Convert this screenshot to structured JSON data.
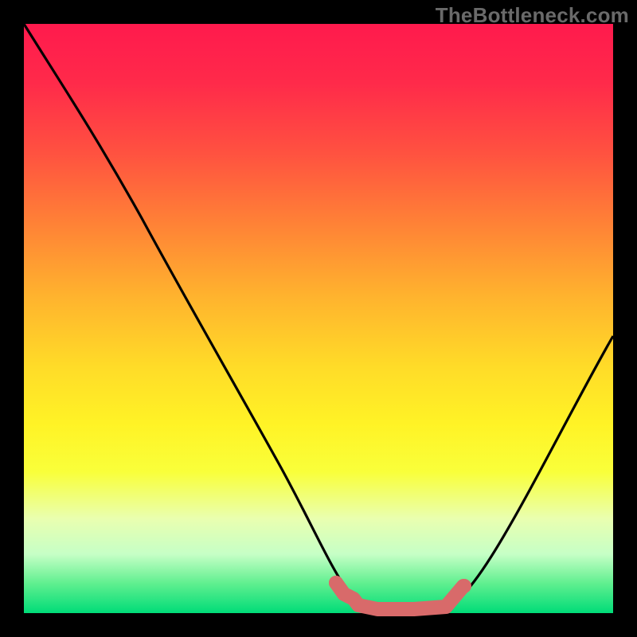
{
  "watermark": "TheBottleneck.com",
  "chart_data": {
    "type": "line",
    "title": "",
    "xlabel": "",
    "ylabel": "",
    "xlim": [
      0,
      1
    ],
    "ylim": [
      0,
      1
    ],
    "series": [
      {
        "name": "curve",
        "color": "#000000",
        "points": [
          {
            "x": 0.0,
            "y": 1.0
          },
          {
            "x": 0.1,
            "y": 0.86
          },
          {
            "x": 0.2,
            "y": 0.67
          },
          {
            "x": 0.3,
            "y": 0.48
          },
          {
            "x": 0.4,
            "y": 0.3
          },
          {
            "x": 0.48,
            "y": 0.14
          },
          {
            "x": 0.53,
            "y": 0.05
          },
          {
            "x": 0.56,
            "y": 0.02
          },
          {
            "x": 0.6,
            "y": 0.01
          },
          {
            "x": 0.66,
            "y": 0.01
          },
          {
            "x": 0.72,
            "y": 0.02
          },
          {
            "x": 0.76,
            "y": 0.06
          },
          {
            "x": 0.82,
            "y": 0.15
          },
          {
            "x": 0.9,
            "y": 0.31
          },
          {
            "x": 1.0,
            "y": 0.53
          }
        ]
      },
      {
        "name": "highlight",
        "color": "#d86a6a",
        "points": [
          {
            "x": 0.53,
            "y": 0.05
          },
          {
            "x": 0.55,
            "y": 0.03
          },
          {
            "x": 0.56,
            "y": 0.02
          },
          {
            "x": 0.6,
            "y": 0.01
          },
          {
            "x": 0.66,
            "y": 0.01
          },
          {
            "x": 0.72,
            "y": 0.02
          },
          {
            "x": 0.75,
            "y": 0.05
          }
        ]
      }
    ]
  },
  "colors": {
    "background": "#000000",
    "gradient_top": "#ff1a4d",
    "gradient_bottom": "#00dc78",
    "watermark": "#6a6a6a",
    "curve": "#000000",
    "highlight": "#d86a6a"
  }
}
